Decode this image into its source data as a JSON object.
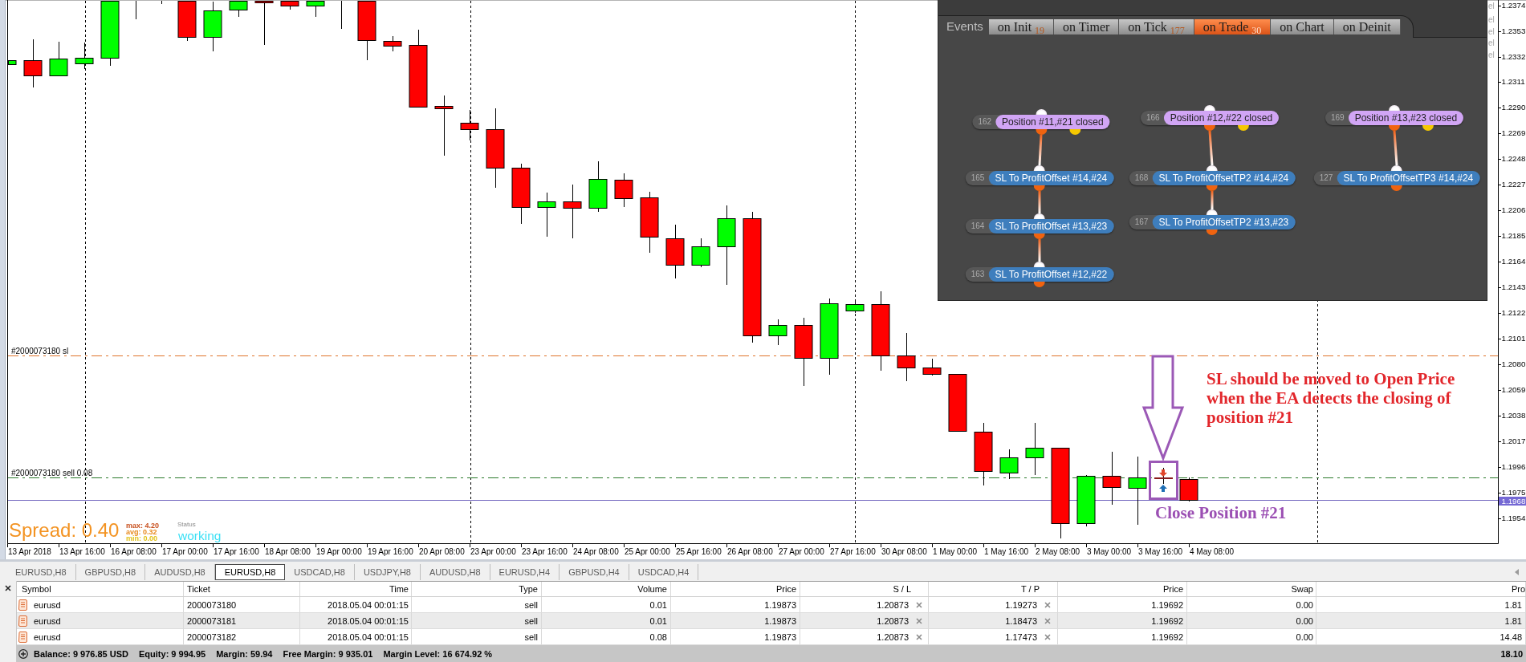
{
  "chart": {
    "order_lines": [
      {
        "kind": "stop_loss",
        "label": "#2000073180 sl"
      },
      {
        "kind": "open",
        "label": "#2000073180 sell 0.08"
      }
    ],
    "price_axis": {
      "labels": [
        "1.2374",
        "1.2353",
        "1.2332",
        "1.2311",
        "1.2290",
        "1.2269",
        "1.2248",
        "1.2227",
        "1.2206",
        "1.2185",
        "1.2164",
        "1.2143",
        "1.2122",
        "1.2101",
        "1.2080",
        "1.2059",
        "1.2038",
        "1.2017",
        "1.1996",
        "1.1975",
        "1.1954"
      ],
      "current_price": "1.1968"
    },
    "time_axis": {
      "labels": [
        "13 Apr 2018",
        "13 Apr 16:00",
        "16 Apr 08:00",
        "17 Apr 00:00",
        "17 Apr 16:00",
        "18 Apr 08:00",
        "19 Apr 00:00",
        "19 Apr 16:00",
        "20 Apr 08:00",
        "23 Apr 00:00",
        "23 Apr 16:00",
        "24 Apr 08:00",
        "25 Apr 00:00",
        "25 Apr 16:00",
        "26 Apr 08:00",
        "27 Apr 00:00",
        "27 Apr 16:00",
        "30 Apr 08:00",
        "1 May 00:00",
        "1 May 16:00",
        "2 May 08:00",
        "3 May 00:00",
        "3 May 16:00",
        "4 May 08:00"
      ]
    },
    "covered_labels": [
      "el",
      "el",
      "el",
      "el",
      "el"
    ],
    "spread_indicator": {
      "label": "Spread: 0.40",
      "stats": [
        {
          "text": "max: 4.20",
          "color": "#c8501e"
        },
        {
          "text": "avg: 0.32",
          "color": "#e88a1e"
        },
        {
          "text": "min: 0.00",
          "color": "#e2c21a"
        }
      ],
      "status_title": "Status",
      "status": "working"
    },
    "annotation": {
      "note": "SL should be moved to Open Price when the EA detects the closing of position #21",
      "marker_label": "Close Position #21"
    }
  },
  "events_panel": {
    "title": "Events",
    "tabs": [
      {
        "label": "on Init",
        "count": "19",
        "selected": false
      },
      {
        "label": "on Timer",
        "selected": false
      },
      {
        "label": "on Tick",
        "count": "177",
        "selected": false
      },
      {
        "label": "on Trade",
        "count": "30",
        "selected": true
      },
      {
        "label": "on Chart",
        "selected": false
      },
      {
        "label": "on Deinit",
        "selected": false
      }
    ],
    "chains": [
      {
        "nodes": [
          {
            "kind": "position",
            "number": "162",
            "label": "Position #11,#21 closed"
          },
          {
            "kind": "order",
            "number": "165",
            "label": "SL To ProfitOffset #14,#24"
          },
          {
            "kind": "order",
            "number": "164",
            "label": "SL To ProfitOffset #13,#23"
          },
          {
            "kind": "order",
            "number": "163",
            "label": "SL To ProfitOffset #12,#22"
          }
        ]
      },
      {
        "nodes": [
          {
            "kind": "position",
            "number": "166",
            "label": "Position #12,#22 closed"
          },
          {
            "kind": "order",
            "number": "168",
            "label": "SL To ProfitOffsetTP2 #14,#24"
          },
          {
            "kind": "order",
            "number": "167",
            "label": "SL To ProfitOffsetTP2 #13,#23"
          }
        ]
      },
      {
        "nodes": [
          {
            "kind": "position",
            "number": "169",
            "label": "Position #13,#23 closed"
          },
          {
            "kind": "order",
            "number": "127",
            "label": "SL To ProfitOffsetTP3 #14,#24"
          }
        ]
      }
    ]
  },
  "chart_tabs": [
    {
      "label": "EURUSD,H8",
      "selected": false
    },
    {
      "label": "GBPUSD,H8",
      "selected": false
    },
    {
      "label": "AUDUSD,H8",
      "selected": false
    },
    {
      "label": "EURUSD,H8",
      "selected": true
    },
    {
      "label": "USDCAD,H8",
      "selected": false
    },
    {
      "label": "USDJPY,H8",
      "selected": false
    },
    {
      "label": "AUDUSD,H8",
      "selected": false
    },
    {
      "label": "EURUSD,H4",
      "selected": false
    },
    {
      "label": "GBPUSD,H4",
      "selected": false
    },
    {
      "label": "USDCAD,H4",
      "selected": false
    }
  ],
  "terminal": {
    "columns": [
      "Symbol",
      "Ticket",
      "Time",
      "Type",
      "Volume",
      "Price",
      "S / L",
      "T / P",
      "Price",
      "Swap",
      "Pro"
    ],
    "rows": [
      {
        "cells": [
          "eurusd",
          "2000073180",
          "2018.05.04 00:01:15",
          "sell",
          "0.01",
          "1.19873",
          "1.20873",
          "1.19273",
          "1.19692",
          "0.00",
          "1.81"
        ]
      },
      {
        "cells": [
          "eurusd",
          "2000073181",
          "2018.05.04 00:01:15",
          "sell",
          "0.01",
          "1.19873",
          "1.20873",
          "1.18473",
          "1.19692",
          "0.00",
          "1.81"
        ]
      },
      {
        "cells": [
          "eurusd",
          "2000073182",
          "2018.05.04 00:01:15",
          "sell",
          "0.08",
          "1.19873",
          "1.20873",
          "1.17473",
          "1.19692",
          "0.00",
          "14.48"
        ]
      }
    ],
    "status_bar": {
      "items": [
        "Balance: 9 976.85 USD",
        "Equity: 9 994.95",
        "Margin: 59.94",
        "Free Margin: 9 935.01",
        "Margin Level: 16 674.92 %"
      ],
      "total": "18.10"
    }
  }
}
